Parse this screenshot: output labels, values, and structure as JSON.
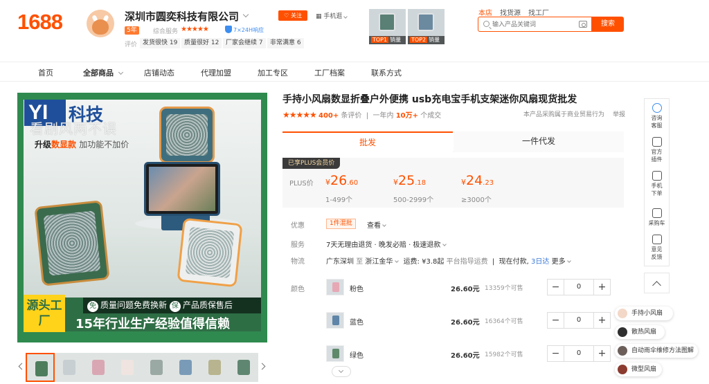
{
  "header": {
    "logo": "1688",
    "shop_name": "深圳市圆奕科技有限公司",
    "years_badge": "5年",
    "service_label": "综合服务",
    "service_stars": "★★★★★",
    "cert_text": "7×24H响应",
    "eval_label": "评价",
    "eval_tags": [
      "发货很快 19",
      "质量很好 12",
      "厂家会继续 7",
      "非常满意 6"
    ],
    "follow_label": "关注",
    "mobile_label": "手机逛",
    "top_images": [
      {
        "tag": "TOP1",
        "text": "销量"
      },
      {
        "tag": "TOP2",
        "text": "销量"
      }
    ],
    "search_tabs": [
      "本店",
      "找货源",
      "找工厂"
    ],
    "search_placeholder": "输入产品关键词",
    "search_button": "搜索"
  },
  "nav": [
    "首页",
    "全部商品",
    "店铺动态",
    "代理加盟",
    "加工专区",
    "工厂档案",
    "联系方式"
  ],
  "gallery": {
    "brand": "YI",
    "brand_cn": "科技",
    "watermark": "看剧风两不误",
    "upgrade_pre": "升级",
    "upgrade_hl": "数显款",
    "upgrade_rest": "加功能不加价",
    "quality_1_icon": "免",
    "quality_1": "质量问题免费换新",
    "quality_2_icon": "保",
    "quality_2": "产品质保售后",
    "source": "源头工厂",
    "slogan": "15年行业生产经验值得信赖",
    "thumb_colors": [
      "#4e7d5c",
      "#c7cfd3",
      "#d9a7b3",
      "#efe4e0",
      "#9aa9a3",
      "#7a9bb8",
      "#b7b48f",
      "#5f8671"
    ]
  },
  "product": {
    "title": "手持小风扇数显折叠户外便携 usb充电宝手机支架迷你风扇现货批发",
    "stars": "★★★★★",
    "reviews_count": "400+",
    "reviews_label": "条评价",
    "year_label": "一年内",
    "deals_count": "10万+",
    "deals_label": "个成交",
    "note": "本产品采购属于商业贸易行为",
    "report": "举报",
    "tab_wholesale": "批发",
    "tab_dropship": "一件代发",
    "plus_badge": "已享PLUS会员价",
    "plus_label": "PLUS价",
    "prices": [
      {
        "yen": "¥",
        "int": "26",
        "dec": ".60",
        "range": "1-499个"
      },
      {
        "yen": "¥",
        "int": "25",
        "dec": ".18",
        "range": "500-2999个"
      },
      {
        "yen": "¥",
        "int": "24",
        "dec": ".23",
        "range": "≥3000个"
      }
    ],
    "promo_label": "优惠",
    "promo_tag": "1件混批",
    "promo_see": "查看",
    "service_label": "服务",
    "service_text": "7天无理由退货 · 晚发必赔 · 极速退款",
    "logistics_label": "物流",
    "from": "广东深圳",
    "to_word": "至",
    "to": "浙江金华",
    "freight": "运费: ¥3.8起",
    "freight_note": "平台指导运费",
    "ship_label": "现在付款,",
    "ship_days": "3日达",
    "ship_more": "更多",
    "color_label": "颜色",
    "skus": [
      {
        "name": "粉色",
        "price": "26.60元",
        "stock": "13359个可售",
        "qty": "0",
        "color": "#e7a8b5"
      },
      {
        "name": "蓝色",
        "price": "26.60元",
        "stock": "16364个可售",
        "qty": "0",
        "color": "#5f86a8"
      },
      {
        "name": "绿色",
        "price": "26.60元",
        "stock": "15982个可售",
        "qty": "0",
        "color": "#5e8a6b"
      }
    ]
  },
  "sidebar": {
    "items": [
      "咨询客服",
      "官方插件",
      "手机下单",
      "采购车",
      "意见反馈"
    ]
  },
  "suggestions": [
    "手持小风扇",
    "散热风扇",
    "自动雨伞维修方法图解",
    "微型风扇"
  ]
}
